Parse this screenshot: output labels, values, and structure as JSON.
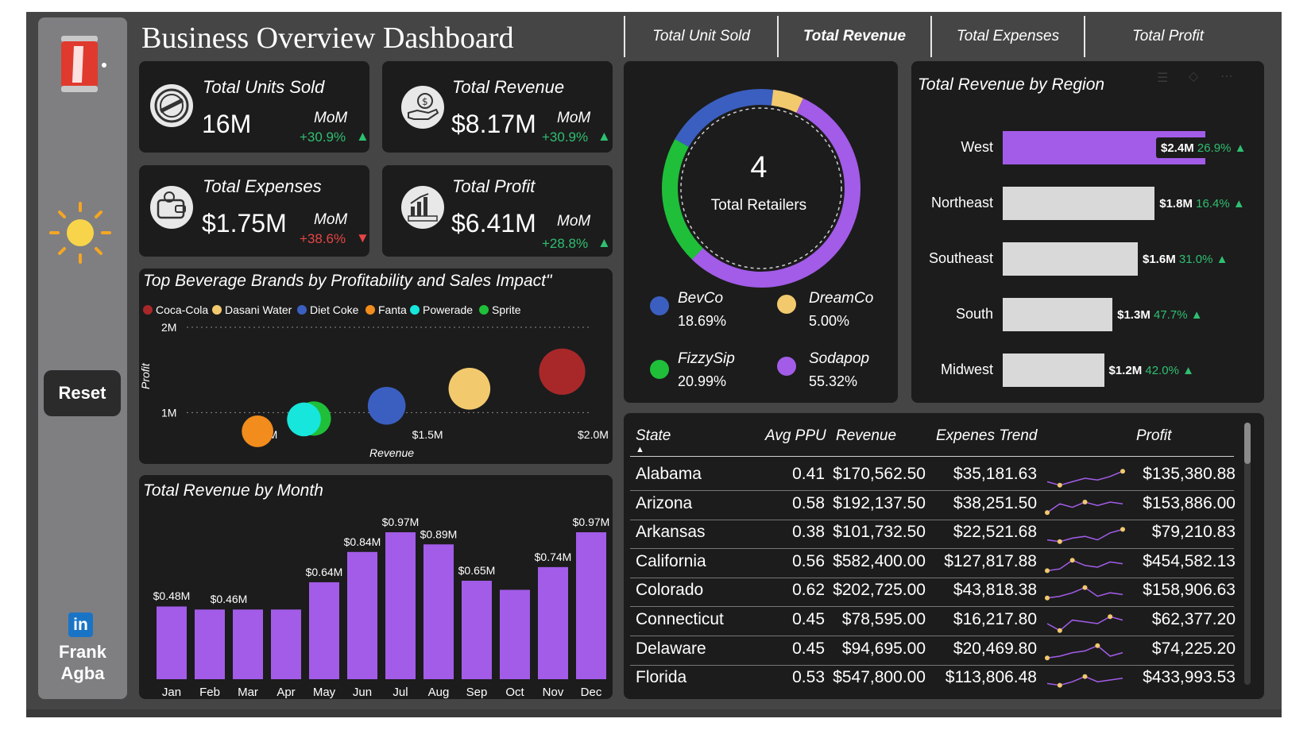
{
  "header": {
    "title": "Business Overview Dashboard"
  },
  "tabs": [
    {
      "label": "Total Unit Sold",
      "active": false
    },
    {
      "label": "Total Revenue",
      "active": true
    },
    {
      "label": "Total Expenses",
      "active": false
    },
    {
      "label": "Total Profit",
      "active": false
    }
  ],
  "sidebar": {
    "reset_label": "Reset",
    "author_first": "Frank",
    "author_last": "Agba",
    "linkedin_text": "in",
    "icons": [
      "soda-can-icon",
      "sun-icon",
      "linkedin-icon"
    ]
  },
  "kpis": [
    {
      "title": "Total Units Sold",
      "value": "16M",
      "mom_label": "MoM",
      "change": "+30.9%",
      "direction": "up",
      "icon": "sold-out-badge-icon"
    },
    {
      "title": "Total Revenue",
      "value": "$8.17M",
      "mom_label": "MoM",
      "change": "+30.9%",
      "direction": "up",
      "icon": "money-hand-icon"
    },
    {
      "title": "Total Expenses",
      "value": "$1.75M",
      "mom_label": "MoM",
      "change": "+38.6%",
      "direction": "down",
      "icon": "wallet-icon"
    },
    {
      "title": "Total Profit",
      "value": "$6.41M",
      "mom_label": "MoM",
      "change": "+28.8%",
      "direction": "up",
      "icon": "profit-chart-icon"
    }
  ],
  "retailers": {
    "count": "4",
    "label": "Total Retailers",
    "items": [
      {
        "name": "BevCo",
        "share": "18.69%",
        "value": 18.69,
        "color": "#3b5fc0"
      },
      {
        "name": "DreamCo",
        "share": "5.00%",
        "value": 5.0,
        "color": "#f2c96d"
      },
      {
        "name": "FizzySip",
        "share": "20.99%",
        "value": 20.99,
        "color": "#1fbf3a"
      },
      {
        "name": "Sodapop",
        "share": "55.32%",
        "value": 55.32,
        "color": "#a25ce8"
      }
    ]
  },
  "region": {
    "title": "Total Revenue by Region",
    "items": [
      {
        "name": "West",
        "value": 2.4,
        "label": "$2.4M",
        "pct": "26.9%",
        "highlight": true
      },
      {
        "name": "Northeast",
        "value": 1.8,
        "label": "$1.8M",
        "pct": "16.4%",
        "highlight": false
      },
      {
        "name": "Southeast",
        "value": 1.6,
        "label": "$1.6M",
        "pct": "31.0%",
        "highlight": false
      },
      {
        "name": "South",
        "value": 1.3,
        "label": "$1.3M",
        "pct": "47.7%",
        "highlight": false
      },
      {
        "name": "Midwest",
        "value": 1.2,
        "label": "$1.2M",
        "pct": "42.0%",
        "highlight": false
      }
    ]
  },
  "chart_data": [
    {
      "type": "scatter",
      "title": "Top Beverage Brands by Profitability and Sales Impact\"",
      "xlabel": "Revenue",
      "ylabel": "Profit",
      "xlim": [
        0.8,
        2.0
      ],
      "ylim": [
        0.5,
        2.0
      ],
      "x_ticks": [
        "$1.0M",
        "$1.5M",
        "$2.0M"
      ],
      "y_ticks": [
        "1M",
        "2M"
      ],
      "legend_position": "top",
      "series": [
        {
          "name": "Coca-Cola",
          "color": "#a8282a",
          "x": 1.91,
          "y": 1.48
        },
        {
          "name": "Dasani Water",
          "color": "#f2c96d",
          "x": 1.63,
          "y": 1.28
        },
        {
          "name": "Diet Coke",
          "color": "#3b5fc0",
          "x": 1.38,
          "y": 1.08
        },
        {
          "name": "Fanta",
          "color": "#f28c1c",
          "x": 0.99,
          "y": 0.78
        },
        {
          "name": "Powerade",
          "color": "#17e6dc",
          "x": 1.13,
          "y": 0.92
        },
        {
          "name": "Sprite",
          "color": "#1fbf3a",
          "x": 1.16,
          "y": 0.93
        }
      ]
    },
    {
      "type": "bar",
      "title": "Total Revenue by Month",
      "categories": [
        "Jan",
        "Feb",
        "Mar",
        "Apr",
        "May",
        "Jun",
        "Jul",
        "Aug",
        "Sep",
        "Oct",
        "Nov",
        "Dec"
      ],
      "values": [
        0.48,
        0.46,
        0.46,
        0.46,
        0.64,
        0.84,
        0.97,
        0.89,
        0.65,
        0.59,
        0.74,
        0.97
      ],
      "labels": [
        "$0.48M",
        "",
        "$0.46M",
        "",
        "$0.64M",
        "$0.84M",
        "$0.97M",
        "$0.89M",
        "$0.65M",
        "",
        "$0.74M",
        "$0.97M"
      ],
      "color": "#a25ce8"
    }
  ],
  "table": {
    "columns": [
      "State",
      "Avg PPU",
      "Revenue",
      "Expenes Trend",
      "Profit"
    ],
    "rows": [
      {
        "state": "Alabama",
        "ppu": "0.41",
        "revenue": "$170,562.50",
        "expenses": "$35,181.63",
        "profit": "$135,380.88"
      },
      {
        "state": "Arizona",
        "ppu": "0.58",
        "revenue": "$192,137.50",
        "expenses": "$38,251.50",
        "profit": "$153,886.00"
      },
      {
        "state": "Arkansas",
        "ppu": "0.38",
        "revenue": "$101,732.50",
        "expenses": "$22,521.68",
        "profit": "$79,210.83"
      },
      {
        "state": "California",
        "ppu": "0.56",
        "revenue": "$582,400.00",
        "expenses": "$127,817.88",
        "profit": "$454,582.13"
      },
      {
        "state": "Colorado",
        "ppu": "0.62",
        "revenue": "$202,725.00",
        "expenses": "$43,818.38",
        "profit": "$158,906.63"
      },
      {
        "state": "Connecticut",
        "ppu": "0.45",
        "revenue": "$78,595.00",
        "expenses": "$16,217.80",
        "profit": "$62,377.20"
      },
      {
        "state": "Delaware",
        "ppu": "0.45",
        "revenue": "$94,695.00",
        "expenses": "$20,469.80",
        "profit": "$74,225.20"
      },
      {
        "state": "Florida",
        "ppu": "0.53",
        "revenue": "$547,800.00",
        "expenses": "$113,806.48",
        "profit": "$433,993.53"
      }
    ]
  },
  "colors": {
    "accent": "#a25ce8",
    "up": "#2fbf71",
    "down": "#e64545",
    "panel": "#1c1c1c",
    "background": "#454545"
  }
}
